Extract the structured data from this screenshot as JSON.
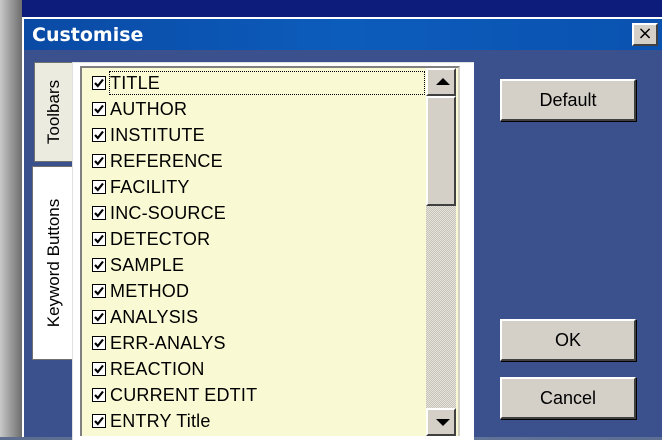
{
  "window": {
    "title": "Customise",
    "close_label": "×"
  },
  "tabs": [
    {
      "label": "Toolbars",
      "selected": false
    },
    {
      "label": "Keyword Buttons",
      "selected": true
    }
  ],
  "keyword_list": {
    "items": [
      {
        "label": "TITLE",
        "checked": true,
        "focused": true
      },
      {
        "label": "AUTHOR",
        "checked": true
      },
      {
        "label": "INSTITUTE",
        "checked": true
      },
      {
        "label": "REFERENCE",
        "checked": true
      },
      {
        "label": "FACILITY",
        "checked": true
      },
      {
        "label": "INC-SOURCE",
        "checked": true
      },
      {
        "label": "DETECTOR",
        "checked": true
      },
      {
        "label": "SAMPLE",
        "checked": true
      },
      {
        "label": "METHOD",
        "checked": true
      },
      {
        "label": "ANALYSIS",
        "checked": true
      },
      {
        "label": "ERR-ANALYS",
        "checked": true
      },
      {
        "label": "REACTION",
        "checked": true
      },
      {
        "label": "CURRENT EDTIT",
        "checked": true
      },
      {
        "label": "ENTRY Title",
        "checked": true
      }
    ]
  },
  "buttons": {
    "default_label": "Default",
    "ok_label": "OK",
    "cancel_label": "Cancel"
  },
  "colors": {
    "titlebar": "#0a4aa4",
    "list_background": "#f9f9d4",
    "button_face": "#d4d0c8"
  }
}
